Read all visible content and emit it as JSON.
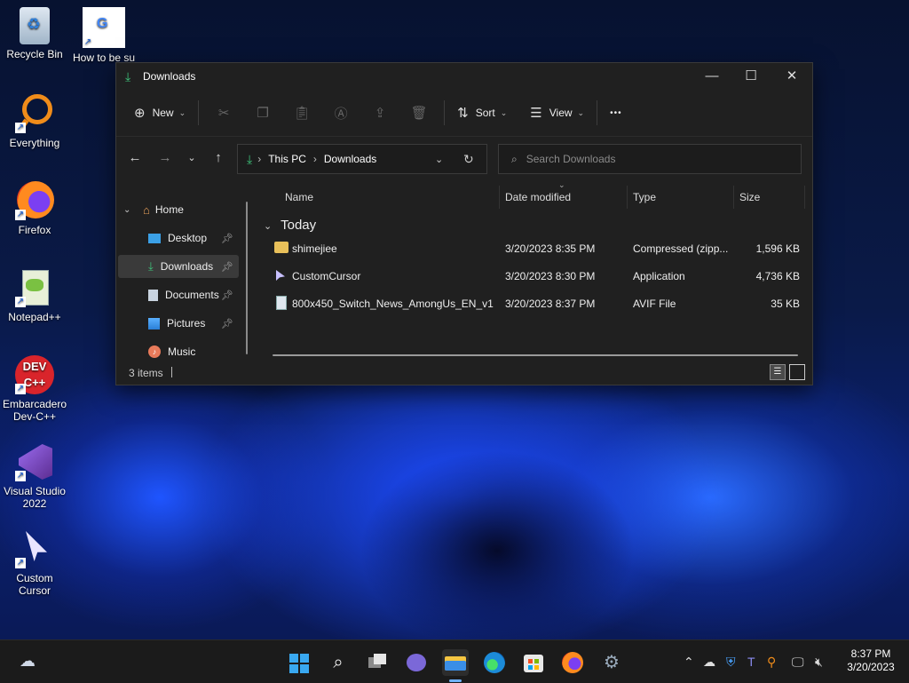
{
  "desktop": {
    "icons": [
      {
        "label": "Recycle Bin"
      },
      {
        "label": "How to be suspiciou..."
      },
      {
        "label": "Everything"
      },
      {
        "label": "Firefox"
      },
      {
        "label": "Notepad++"
      },
      {
        "label": "Embarcadero Dev-C++"
      },
      {
        "label": "Visual Studio 2022"
      },
      {
        "label": "Custom Cursor"
      }
    ]
  },
  "window": {
    "title": "Downloads",
    "toolbar": {
      "new_label": "New",
      "sort_label": "Sort",
      "view_label": "View",
      "more_label": "•••"
    },
    "address": {
      "crumbs": [
        "This PC",
        "Downloads"
      ]
    },
    "search": {
      "placeholder": "Search Downloads"
    },
    "sidebar": {
      "items": [
        {
          "label": "Home"
        },
        {
          "label": "Desktop"
        },
        {
          "label": "Downloads"
        },
        {
          "label": "Documents"
        },
        {
          "label": "Pictures"
        },
        {
          "label": "Music"
        }
      ]
    },
    "columns": {
      "name": "Name",
      "date": "Date modified",
      "type": "Type",
      "size": "Size"
    },
    "group": "Today",
    "files": [
      {
        "name": "shimejiee",
        "date": "3/20/2023 8:35 PM",
        "type": "Compressed (zipp...",
        "size": "1,596 KB"
      },
      {
        "name": "CustomCursor",
        "date": "3/20/2023 8:30 PM",
        "type": "Application",
        "size": "4,736 KB"
      },
      {
        "name": "800x450_Switch_News_AmongUs_EN_v1",
        "date": "3/20/2023 8:37 PM",
        "type": "AVIF File",
        "size": "35 KB"
      }
    ],
    "status": {
      "items": "3 items"
    }
  },
  "taskbar": {
    "clock": {
      "time": "8:37 PM",
      "date": "3/20/2023"
    }
  },
  "colors": {
    "accent": "#3ec27a",
    "selection": "#3a3a3a",
    "window_bg": "#202020"
  }
}
